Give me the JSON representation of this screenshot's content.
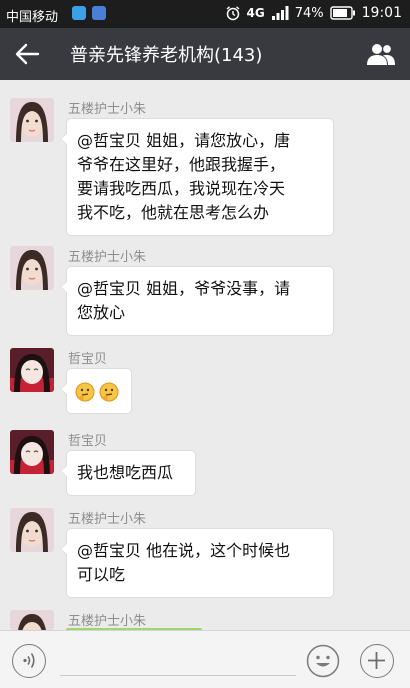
{
  "status_bar": {
    "carrier": "中国移动",
    "network": "4G",
    "battery": "74%",
    "time": "19:01"
  },
  "header": {
    "title": "普亲先锋养老机构(143)"
  },
  "messages": [
    {
      "sender": "五楼护士小朱",
      "lines": [
        "@哲宝贝 姐姐，请您放心，唐",
        "爷爷在这里好，他跟我握手，",
        "要请我吃西瓜，我说现在冷天",
        "我不吃，他就在思考怎么办"
      ]
    },
    {
      "sender": "五楼护士小朱",
      "lines": [
        "@哲宝贝 姐姐，爷爷没事，请",
        "您放心"
      ]
    },
    {
      "sender": "哲宝贝",
      "emoji_count": 2
    },
    {
      "sender": "哲宝贝",
      "lines": [
        "我也想吃西瓜"
      ]
    },
    {
      "sender": "五楼护士小朱",
      "lines": [
        "@哲宝贝 他在说，这个时候也",
        "可以吃"
      ]
    },
    {
      "sender": "五楼护士小朱"
    }
  ],
  "colors": {
    "app_bar": "#393a3f",
    "status_bar": "#1d1d1d",
    "chat_bg": "#ebebeb",
    "image_bubble": "#9ed86a"
  },
  "icons": {
    "back": "arrow-left-icon",
    "group_info": "people-icon",
    "voice": "voice-icon",
    "emoji": "smile-icon",
    "more": "plus-icon"
  }
}
